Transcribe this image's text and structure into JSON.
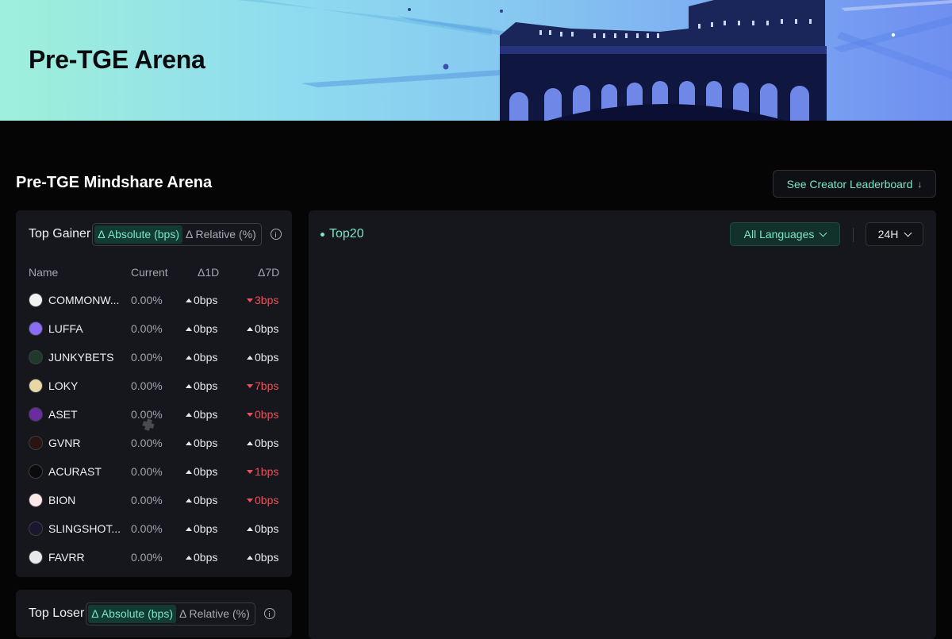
{
  "banner": {
    "title": "Pre-TGE Arena"
  },
  "section": {
    "title": "Pre-TGE Mindshare Arena",
    "creator_button": "See Creator Leaderboard"
  },
  "gainer": {
    "title": "Top Gainer",
    "toggle_absolute": "Δ Absolute (bps)",
    "toggle_relative": "Δ Relative (%)",
    "columns": {
      "name": "Name",
      "current": "Current",
      "d1": "Δ1D",
      "d7": "Δ7D"
    },
    "rows": [
      {
        "name": "COMMONW...",
        "current": "0.00%",
        "d1": "0bps",
        "d1_dir": "up",
        "d7": "3bps",
        "d7_dir": "down",
        "logo_color": "#f2f2f2"
      },
      {
        "name": "LUFFA",
        "current": "0.00%",
        "d1": "0bps",
        "d1_dir": "up",
        "d7": "0bps",
        "d7_dir": "up",
        "logo_color": "#8b6cf5"
      },
      {
        "name": "JUNKYBETS",
        "current": "0.00%",
        "d1": "0bps",
        "d1_dir": "up",
        "d7": "0bps",
        "d7_dir": "up",
        "logo_color": "#1f3a2a"
      },
      {
        "name": "LOKY",
        "current": "0.00%",
        "d1": "0bps",
        "d1_dir": "up",
        "d7": "7bps",
        "d7_dir": "down",
        "logo_color": "#e9d8a6"
      },
      {
        "name": "ASET",
        "current": "0.00%",
        "d1": "0bps",
        "d1_dir": "up",
        "d7": "0bps",
        "d7_dir": "down",
        "logo_color": "#6a2ca0"
      },
      {
        "name": "GVNR",
        "current": "0.00%",
        "d1": "0bps",
        "d1_dir": "up",
        "d7": "0bps",
        "d7_dir": "up",
        "logo_color": "#2a1410"
      },
      {
        "name": "ACURAST",
        "current": "0.00%",
        "d1": "0bps",
        "d1_dir": "up",
        "d7": "1bps",
        "d7_dir": "down",
        "logo_color": "#0b0b0b"
      },
      {
        "name": "BION",
        "current": "0.00%",
        "d1": "0bps",
        "d1_dir": "up",
        "d7": "0bps",
        "d7_dir": "down",
        "logo_color": "#fbe9e9"
      },
      {
        "name": "SLINGSHOT...",
        "current": "0.00%",
        "d1": "0bps",
        "d1_dir": "up",
        "d7": "0bps",
        "d7_dir": "up",
        "logo_color": "#1a1630"
      },
      {
        "name": "FAVRR",
        "current": "0.00%",
        "d1": "0bps",
        "d1_dir": "up",
        "d7": "0bps",
        "d7_dir": "up",
        "logo_color": "#e8e8ea"
      }
    ]
  },
  "loser": {
    "title": "Top Loser",
    "toggle_absolute": "Δ Absolute (bps)",
    "toggle_relative": "Δ Relative (%)"
  },
  "right_panel": {
    "title": "Top20",
    "language_select": "All Languages",
    "timeframe_select": "24H"
  },
  "colors": {
    "accent": "#7de6c8",
    "down": "#ef4e59",
    "background": "#050505",
    "card": "#16171c"
  }
}
